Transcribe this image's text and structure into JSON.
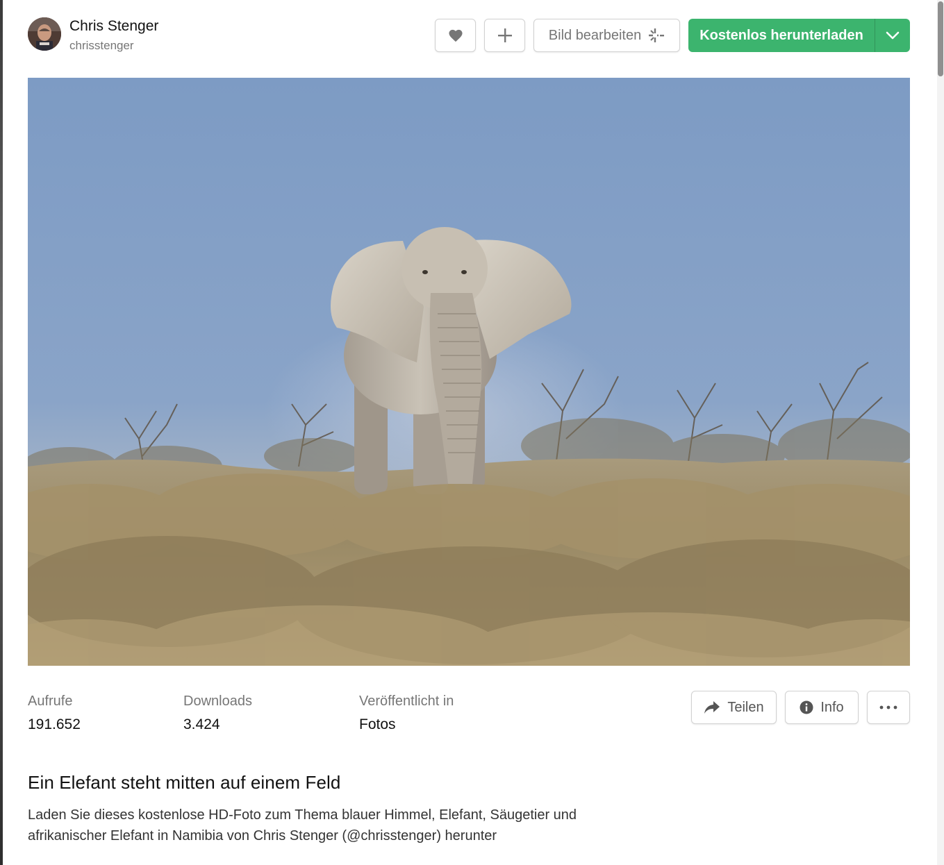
{
  "author": {
    "name": "Chris Stenger",
    "handle": "chrisstenger"
  },
  "toolbar": {
    "like_icon": "heart-icon",
    "add_icon": "plus-icon",
    "edit_label": "Bild bearbeiten",
    "edit_icon": "sparkle-edit-icon",
    "download_label": "Kostenlos herunterladen",
    "download_menu_icon": "chevron-down-icon",
    "download_color": "#3cb46e"
  },
  "photo": {
    "subject": "elephant-photo"
  },
  "stats": {
    "views_label": "Aufrufe",
    "views_value": "191.652",
    "downloads_label": "Downloads",
    "downloads_value": "3.424",
    "published_label": "Veröffentlicht in",
    "published_value": "Fotos"
  },
  "actions": {
    "share_label": "Teilen",
    "share_icon": "share-arrow-icon",
    "info_label": "Info",
    "info_icon": "info-icon",
    "more_icon": "more-dots-icon"
  },
  "content": {
    "title": "Ein Elefant steht mitten auf einem Feld",
    "description": "Laden Sie dieses kostenlose HD-Foto zum Thema blauer Himmel, Elefant, Säugetier und afrikanischer Elefant in Namibia von Chris Stenger (@chrisstenger) herunter"
  }
}
